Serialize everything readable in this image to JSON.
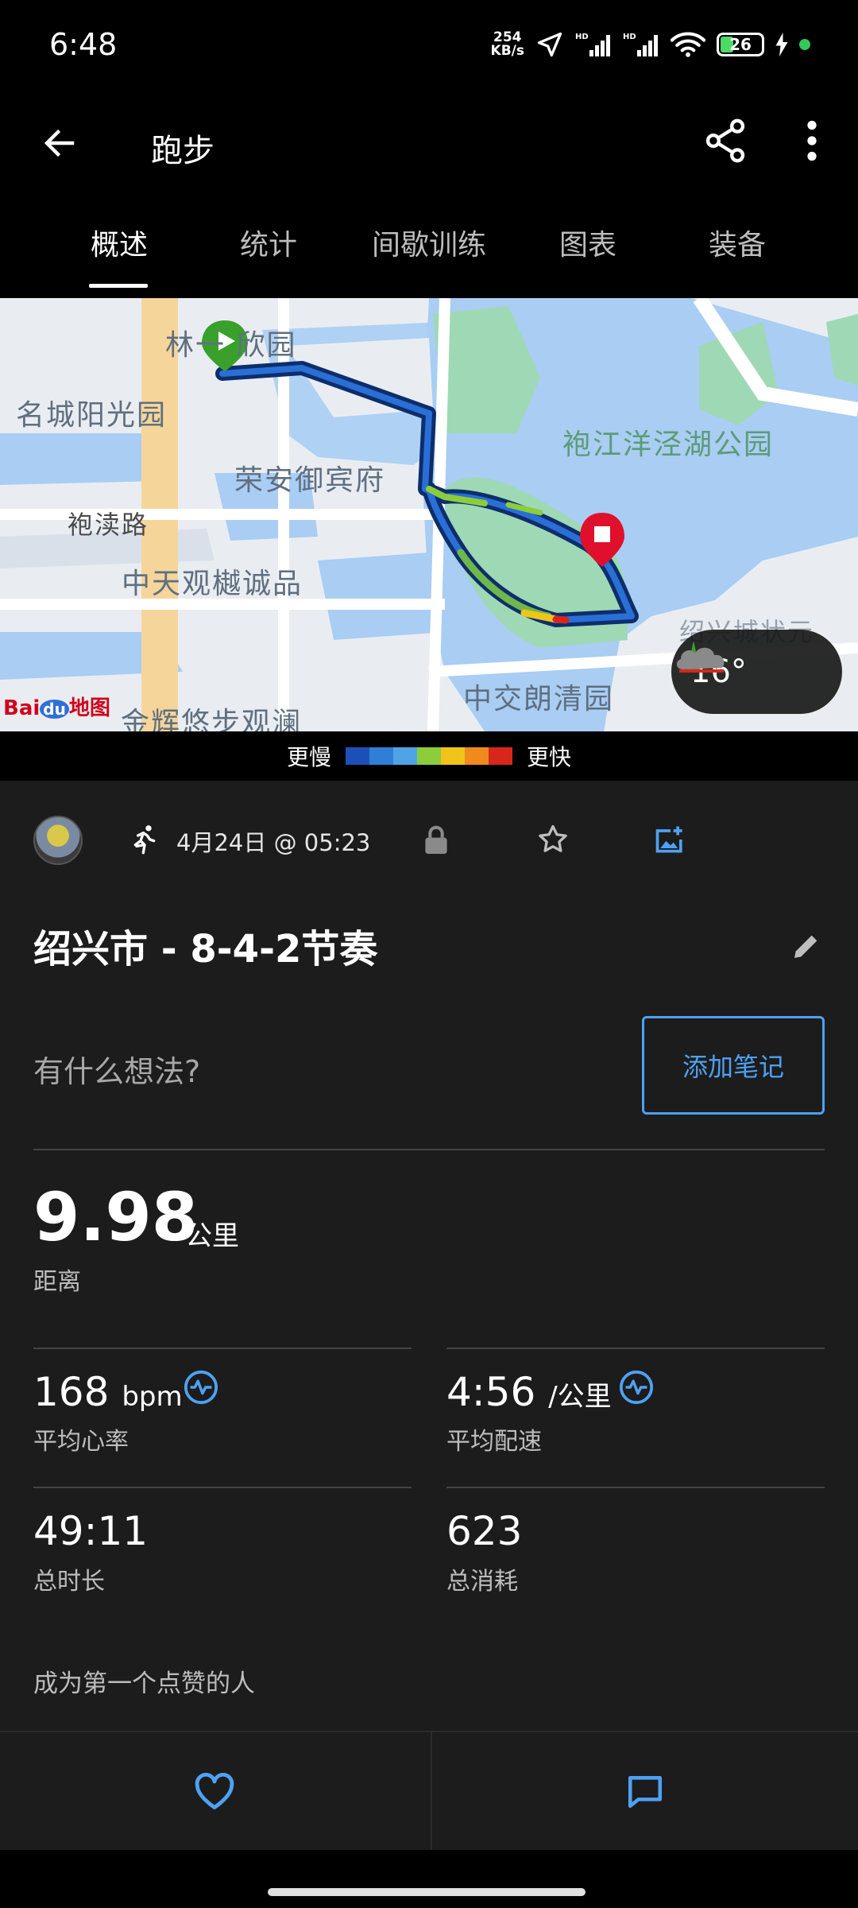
{
  "status_bar": {
    "time": "6:48",
    "net_speed_value": "254",
    "net_speed_unit": "KB/s",
    "battery": "26"
  },
  "app_bar": {
    "title": "跑步"
  },
  "tabs": [
    {
      "label": "概述",
      "active": true
    },
    {
      "label": "统计",
      "active": false
    },
    {
      "label": "间歇训练",
      "active": false
    },
    {
      "label": "图表",
      "active": false
    },
    {
      "label": "装备",
      "active": false
    }
  ],
  "map": {
    "labels": {
      "linyi": "林一 欣园",
      "mingcheng": "名城阳光园",
      "rongan": "荣安御宾府",
      "paodu": "袍渎路",
      "zhongtian": "中天观樾诚品",
      "jinhui": "金辉悠步观澜",
      "zhongjiao": "中交朗清园",
      "park": "袍江洋泾湖公园",
      "corner": "绍兴城状元"
    },
    "provider_logo": {
      "bai": "Bai",
      "du": "du",
      "suffix": "地图"
    },
    "weather": {
      "temp": "16°",
      "icon": "cloud-night-icon"
    }
  },
  "legend": {
    "slow_label": "更慢",
    "fast_label": "更快",
    "colors": [
      "#1d4fb8",
      "#2f7fd6",
      "#4fa3e6",
      "#8ccd3a",
      "#f0c419",
      "#f08a1c",
      "#d9261c"
    ]
  },
  "activity": {
    "date": "4月24日 @ 05:23",
    "title": "绍兴市 - 8-4-2节奏",
    "notes_prompt": "有什么想法?",
    "add_note_label": "添加笔记",
    "distance": {
      "value": "9.98",
      "unit": "公里",
      "label": "距离"
    },
    "stats": {
      "heart_rate": {
        "value": "168",
        "unit": "bpm",
        "label": "平均心率"
      },
      "pace": {
        "value": "4:56",
        "unit": "/公里",
        "label": "平均配速"
      },
      "duration": {
        "value": "49:11",
        "label": "总时长"
      },
      "calories": {
        "value": "623",
        "label": "总消耗"
      }
    },
    "likes_text": "成为第一个点赞的人"
  },
  "colors": {
    "accent": "#4ea1f3",
    "start_pin": "#3aa02c",
    "end_pin": "#e0102c"
  }
}
